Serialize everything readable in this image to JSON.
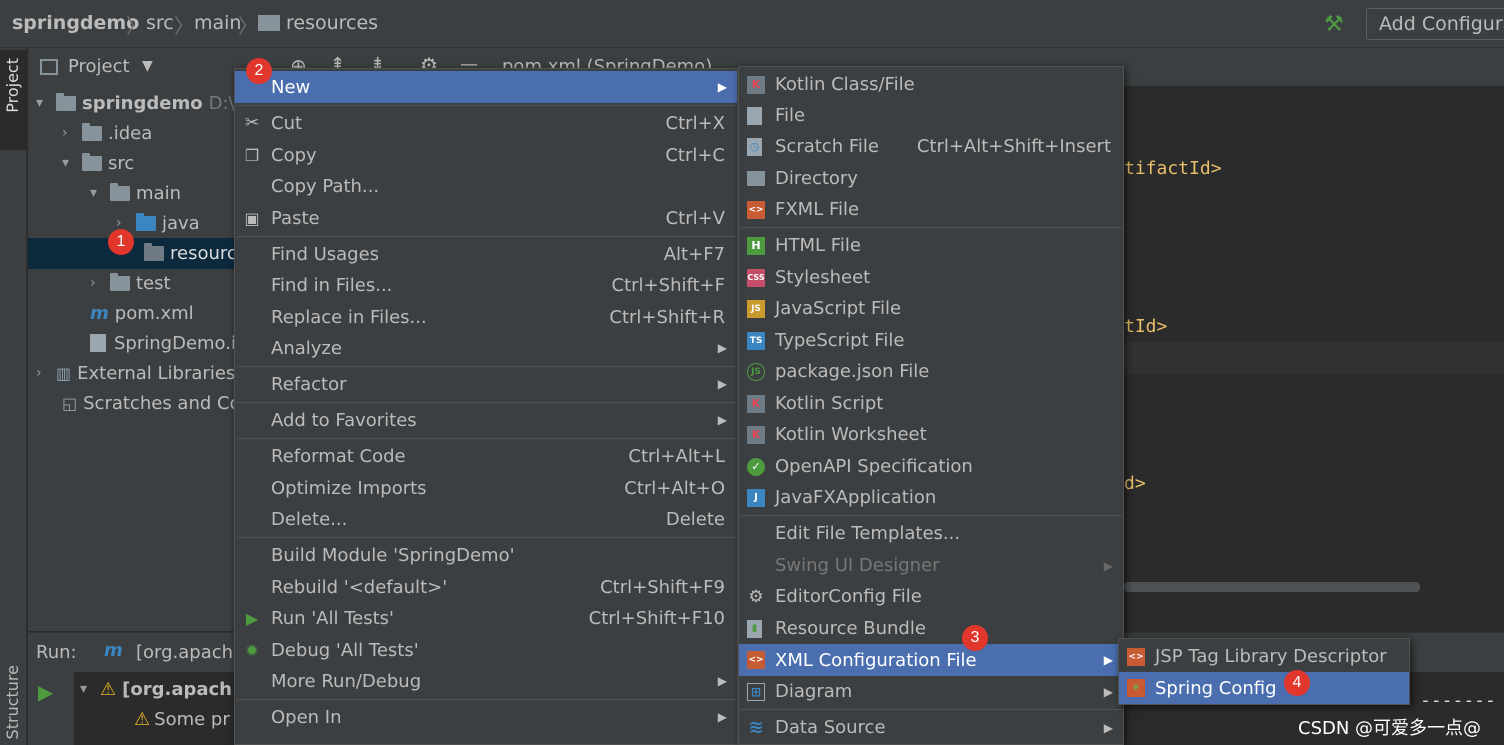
{
  "breadcrumbs": [
    "springdemo",
    "src",
    "main",
    "resources"
  ],
  "toolbar": {
    "add_config": "Add Configura"
  },
  "left_strip": {
    "project_tab": "Project",
    "structure_tab": "Structure"
  },
  "project_panel": {
    "title": "Project",
    "tree": [
      {
        "label": "springdemo",
        "path_hint": "D:\\"
      },
      {
        "label": ".idea"
      },
      {
        "label": "src"
      },
      {
        "label": "main"
      },
      {
        "label": "java"
      },
      {
        "label": "resourc"
      },
      {
        "label": "test"
      },
      {
        "label": "pom.xml"
      },
      {
        "label": "SpringDemo.i"
      },
      {
        "label": "External Libraries"
      },
      {
        "label": "Scratches and Co"
      }
    ]
  },
  "editor": {
    "tab_label": "pom.xml (SpringDemo)",
    "code_lines": [
      "tifactId>",
      "tId>",
      "d>"
    ]
  },
  "run_panel": {
    "label": "Run:",
    "config": "[org.apache",
    "item1": "[org.apach",
    "item2": "Some pr"
  },
  "context_menu": {
    "items": [
      {
        "label": "New",
        "active": true
      },
      {
        "label": "Cut",
        "shortcut": "Ctrl+X"
      },
      {
        "label": "Copy",
        "shortcut": "Ctrl+C"
      },
      {
        "label": "Copy Path..."
      },
      {
        "label": "Paste",
        "shortcut": "Ctrl+V"
      },
      {
        "label": "Find Usages",
        "shortcut": "Alt+F7"
      },
      {
        "label": "Find in Files...",
        "shortcut": "Ctrl+Shift+F"
      },
      {
        "label": "Replace in Files...",
        "shortcut": "Ctrl+Shift+R"
      },
      {
        "label": "Analyze"
      },
      {
        "label": "Refactor"
      },
      {
        "label": "Add to Favorites"
      },
      {
        "label": "Reformat Code",
        "shortcut": "Ctrl+Alt+L"
      },
      {
        "label": "Optimize Imports",
        "shortcut": "Ctrl+Alt+O"
      },
      {
        "label": "Delete...",
        "shortcut": "Delete"
      },
      {
        "label": "Build Module 'SpringDemo'"
      },
      {
        "label": "Rebuild '<default>'",
        "shortcut": "Ctrl+Shift+F9"
      },
      {
        "label": "Run 'All Tests'",
        "shortcut": "Ctrl+Shift+F10"
      },
      {
        "label": "Debug 'All Tests'"
      },
      {
        "label": "More Run/Debug"
      },
      {
        "label": "Open In"
      }
    ]
  },
  "new_submenu": {
    "items": [
      {
        "label": "Kotlin Class/File"
      },
      {
        "label": "File"
      },
      {
        "label": "Scratch File",
        "shortcut": "Ctrl+Alt+Shift+Insert"
      },
      {
        "label": "Directory"
      },
      {
        "label": "FXML File"
      },
      {
        "label": "HTML File"
      },
      {
        "label": "Stylesheet"
      },
      {
        "label": "JavaScript File"
      },
      {
        "label": "TypeScript File"
      },
      {
        "label": "package.json File"
      },
      {
        "label": "Kotlin Script"
      },
      {
        "label": "Kotlin Worksheet"
      },
      {
        "label": "OpenAPI Specification"
      },
      {
        "label": "JavaFXApplication"
      },
      {
        "label": "Edit File Templates..."
      },
      {
        "label": "Swing UI Designer"
      },
      {
        "label": "EditorConfig File"
      },
      {
        "label": "Resource Bundle"
      },
      {
        "label": "XML Configuration File",
        "active": true
      },
      {
        "label": "Diagram"
      },
      {
        "label": "Data Source"
      }
    ]
  },
  "xml_submenu": {
    "items": [
      {
        "label": "JSP Tag Library Descriptor"
      },
      {
        "label": "Spring Config",
        "active": true
      }
    ]
  },
  "annotations": [
    "1",
    "2",
    "3",
    "4"
  ],
  "watermark": "CSDN @可爱多一点@",
  "colors": {
    "menu_bg": "#3c3f41",
    "active": "#4b6eaf",
    "editor_bg": "#2b2b2b",
    "badge": "#e1362c",
    "selection": "#0d293e"
  }
}
